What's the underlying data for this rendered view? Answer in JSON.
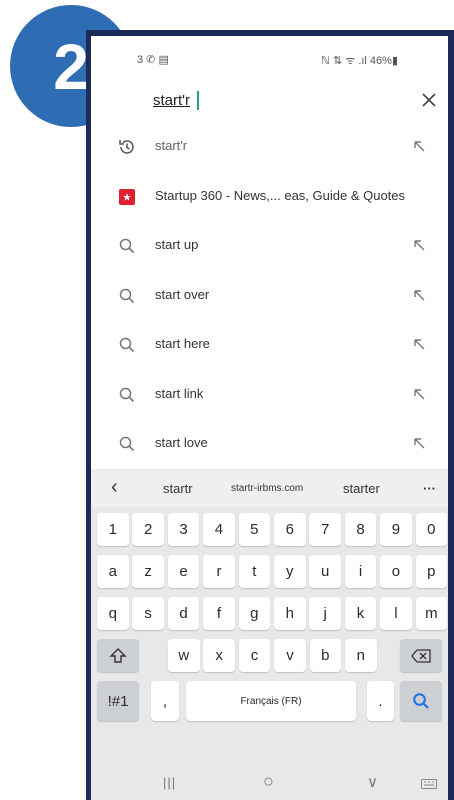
{
  "badge": {
    "number": "2",
    "color": "#2e6db4"
  },
  "status_bar": {
    "left_text": "3 ✆ ▤",
    "right_text": "ℕ ⇅ ᯤ .ıl 46%▮"
  },
  "search": {
    "value": "start'r",
    "placeholder": ""
  },
  "suggestions": [
    {
      "type": "history",
      "icon": "history-icon",
      "text": "start'r",
      "has_arrow": true
    },
    {
      "type": "app",
      "icon": "app-icon",
      "text": "Startup 360 - News,... eas, Guide & Quotes",
      "has_arrow": false
    },
    {
      "type": "search",
      "icon": "search-icon",
      "text": "start up",
      "has_arrow": true
    },
    {
      "type": "search",
      "icon": "search-icon",
      "text": "start over",
      "has_arrow": true
    },
    {
      "type": "search",
      "icon": "search-icon",
      "text": "start here",
      "has_arrow": true
    },
    {
      "type": "search",
      "icon": "search-icon",
      "text": "start link",
      "has_arrow": true
    },
    {
      "type": "search",
      "icon": "search-icon",
      "text": "start love",
      "has_arrow": true
    }
  ],
  "keyboard": {
    "predictions": [
      "startr",
      "startr-irbms.com",
      "starter"
    ],
    "more_label": "···",
    "back_label": "‹",
    "row_numbers": [
      "1",
      "2",
      "3",
      "4",
      "5",
      "6",
      "7",
      "8",
      "9",
      "0"
    ],
    "row1": [
      "a",
      "z",
      "e",
      "r",
      "t",
      "y",
      "u",
      "i",
      "o",
      "p"
    ],
    "row2": [
      "q",
      "s",
      "d",
      "f",
      "g",
      "h",
      "j",
      "k",
      "l",
      "m"
    ],
    "row3": [
      "w",
      "x",
      "c",
      "v",
      "b",
      "n"
    ],
    "symbols_label": "!#1",
    "comma_label": ",",
    "space_label": "Français (FR)",
    "period_label": ".",
    "accent_color": "#1a73e8"
  },
  "nav": {
    "recents": "|||",
    "home": "○",
    "back": "∨"
  }
}
